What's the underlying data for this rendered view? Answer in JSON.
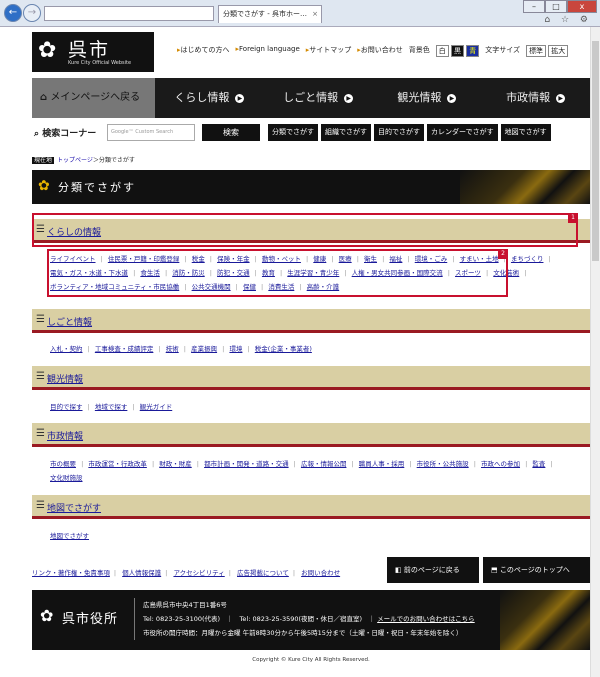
{
  "browser": {
    "address": "",
    "tab_title": "分類でさがす - 呉市ホー…",
    "tab_close": "×",
    "win_min": "–",
    "win_max": "□",
    "win_close": "x",
    "back_glyph": "←",
    "fwd_glyph": "→",
    "icons": "⌂ ☆ ⚙"
  },
  "header": {
    "logo_mark": "✿",
    "logo_name": "呉市",
    "logo_sub": "Kure City Official Website",
    "links": [
      "はじめての方へ",
      "Foreign language",
      "サイトマップ",
      "お問い合わせ"
    ],
    "bg_label": "背景色",
    "bg_white": "白",
    "bg_black": "黒",
    "bg_blue": "青",
    "font_label": "文字サイズ",
    "font_std": "標準",
    "font_big": "拡大"
  },
  "gnav": {
    "home": "メインページへ戻る",
    "items": [
      "くらし情報",
      "しごと情報",
      "観光情報",
      "市政情報"
    ]
  },
  "search": {
    "label": "検索コーナー",
    "placeholder": "Google™ Custom Search",
    "button": "検索",
    "quick": [
      "分類でさがす",
      "組織でさがす",
      "目的でさがす",
      "カレンダーでさがす",
      "地図でさがす"
    ]
  },
  "breadcrumb": {
    "here": "現在地",
    "top": "トップページ",
    "sep": "＞",
    "current": "分類でさがす"
  },
  "page_title": "分類でさがす",
  "sections": [
    {
      "title": "くらしの情報",
      "links": [
        "ライフイベント",
        "住民票・戸籍・印鑑登録",
        "税金",
        "保険・年金",
        "動物・ペット",
        "健康",
        "医療",
        "衛生",
        "福祉",
        "環境・ごみ",
        "すまい・土地",
        "まちづくり",
        "電気・ガス・水道・下水道",
        "食生活",
        "消防・防災",
        "防犯・交通",
        "教育",
        "生涯学習・青少年",
        "人権・男女共同参画・国際交流",
        "スポーツ",
        "文化芸術",
        "ボランティア・地域コミュニティ・市民協働",
        "公共交通機関",
        "保健",
        "消費生活",
        "高齢・介護"
      ]
    },
    {
      "title": "しごと情報",
      "links": [
        "入札・契約",
        "工事検査・成績評定",
        "技術",
        "産業振興",
        "環境",
        "税金(企業・事業者)"
      ]
    },
    {
      "title": "観光情報",
      "links": [
        "目的で探す",
        "地域で探す",
        "観光ガイド"
      ]
    },
    {
      "title": "市政情報",
      "links": [
        "市の概要",
        "市政運営・行政改革",
        "財政・財産",
        "都市計画・開発・道路・交通",
        "広報・情報公開",
        "職員人事・採用",
        "市役所・公共施設",
        "市政への参加",
        "監査",
        "文化財施設"
      ]
    },
    {
      "title": "地図でさがす",
      "links": [
        "地図でさがす"
      ]
    }
  ],
  "highlights": [
    "1",
    "2"
  ],
  "footer_links": [
    "リンク・著作権・免責事項",
    "個人情報保護",
    "アクセシビリティ",
    "広告掲載について",
    "お問い合わせ"
  ],
  "page_buttons": {
    "prev": "前のページに戻る",
    "top": "このページのトップへ"
  },
  "footer": {
    "mark": "✿",
    "name": "呉市役所",
    "address": "広島県呉市中央4丁目1番6号",
    "tel": "Tel: 0823-25-3100(代表)　｜　Tel: 0823-25-3590(夜間・休日／宿直室)　｜",
    "mail": "メールでのお問い合わせはこちら",
    "hours": "市役所の開庁時間：月曜から金曜 午前8時30分から午後5時15分まで（土曜・日曜・祝日・年末年始を除く）"
  },
  "copyright": "Copyright © Kure City All Rights Reserved."
}
